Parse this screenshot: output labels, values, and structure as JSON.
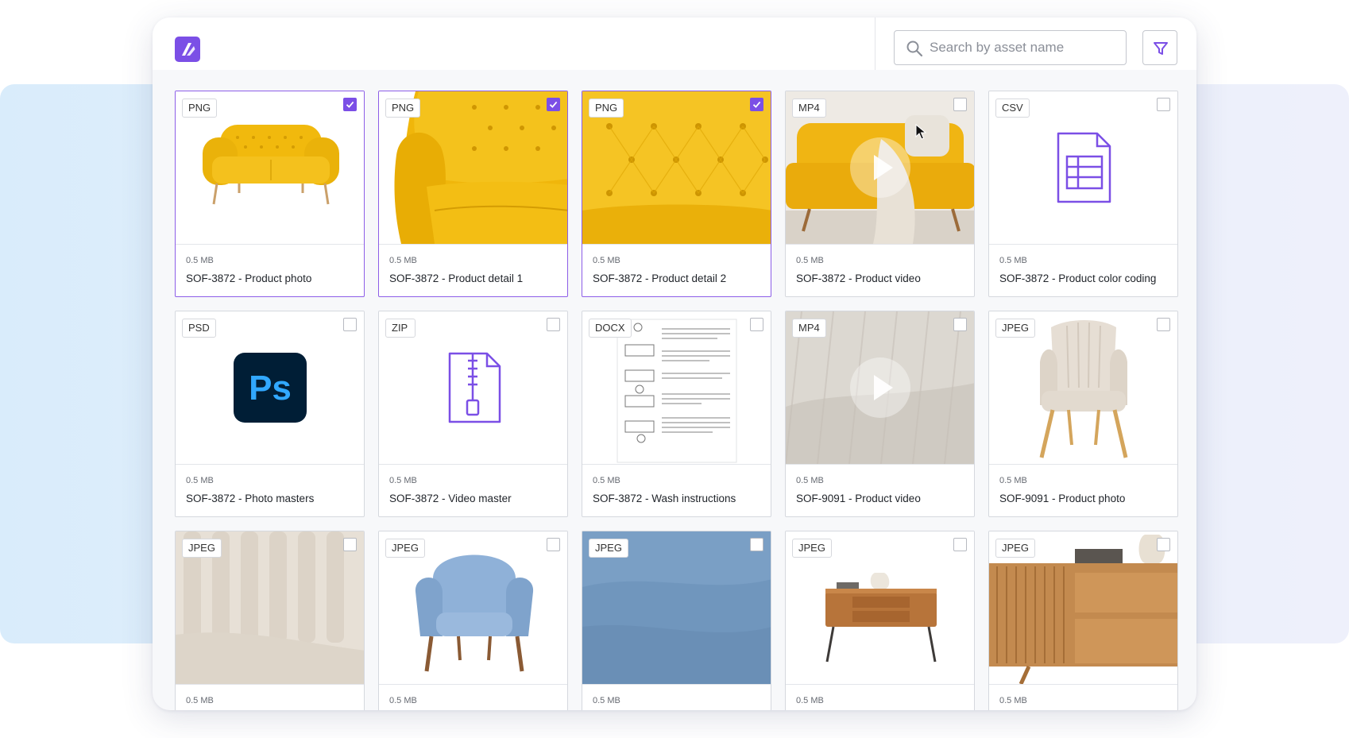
{
  "app": {
    "search_placeholder": "Search by asset name"
  },
  "colors": {
    "accent": "#7b4fe6",
    "selected_border": "#8d5ee8",
    "band": "#e1effb"
  },
  "assets": [
    {
      "type": "PNG",
      "size": "0.5 MB",
      "name": "SOF-3872 - Product photo",
      "checked": true
    },
    {
      "type": "PNG",
      "size": "0.5 MB",
      "name": "SOF-3872 - Product detail 1",
      "checked": true
    },
    {
      "type": "PNG",
      "size": "0.5 MB",
      "name": "SOF-3872 - Product detail 2",
      "checked": true
    },
    {
      "type": "MP4",
      "size": "0.5 MB",
      "name": "SOF-3872 - Product video",
      "checked": false
    },
    {
      "type": "CSV",
      "size": "0.5 MB",
      "name": "SOF-3872 - Product color coding",
      "checked": false
    },
    {
      "type": "PSD",
      "size": "0.5 MB",
      "name": "SOF-3872 - Photo masters",
      "checked": false
    },
    {
      "type": "ZIP",
      "size": "0.5 MB",
      "name": "SOF-3872 - Video master",
      "checked": false
    },
    {
      "type": "DOCX",
      "size": "0.5 MB",
      "name": "SOF-3872 - Wash instructions",
      "checked": false
    },
    {
      "type": "MP4",
      "size": "0.5 MB",
      "name": "SOF-9091 - Product video",
      "checked": false
    },
    {
      "type": "JPEG",
      "size": "0.5 MB",
      "name": "SOF-9091 - Product photo",
      "checked": false
    },
    {
      "type": "JPEG",
      "size": "0.5 MB",
      "name": "",
      "checked": false
    },
    {
      "type": "JPEG",
      "size": "0.5 MB",
      "name": "",
      "checked": false
    },
    {
      "type": "JPEG",
      "size": "0.5 MB",
      "name": "",
      "checked": false
    },
    {
      "type": "JPEG",
      "size": "0.5 MB",
      "name": "",
      "checked": false
    },
    {
      "type": "JPEG",
      "size": "0.5 MB",
      "name": "",
      "checked": false
    }
  ],
  "thumb_icons": [
    "yellow-sofa-image",
    "sofa-cushion-detail-image",
    "tufted-fabric-image",
    "living-room-video-thumbnail",
    "spreadsheet-icon",
    "photoshop-icon",
    "zip-file-icon",
    "document-preview",
    "fabric-video-thumbnail",
    "beige-armchair-image",
    "cream-fabric-image",
    "blue-armchair-image",
    "blue-fabric-image",
    "wooden-side-table-image",
    "wooden-sideboard-image"
  ]
}
